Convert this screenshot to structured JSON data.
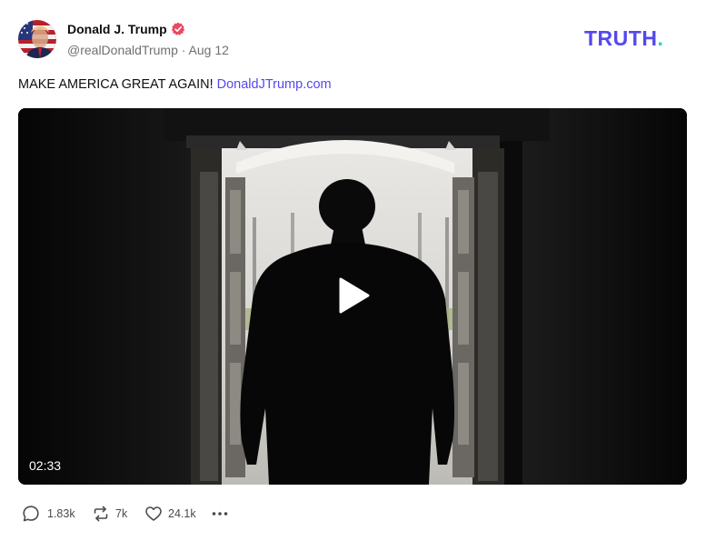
{
  "author": {
    "name": "Donald J. Trump",
    "handle": "@realDonaldTrump",
    "separator": "·",
    "date": "Aug 12",
    "verified_icon": "verified-badge-icon"
  },
  "brand": {
    "logo_text": "TRUTH",
    "logo_dot": ".",
    "logo_color": "#5448ee",
    "dot_color": "#26d4b8"
  },
  "post": {
    "text": "MAKE AMERICA GREAT AGAIN!",
    "link_text": "DonaldJTrump.com",
    "link_color": "#5448ee"
  },
  "video": {
    "duration": "02:33",
    "play_icon": "play-icon"
  },
  "actions": {
    "replies": {
      "icon": "reply-icon",
      "count": "1.83k"
    },
    "retruths": {
      "icon": "retruth-icon",
      "count": "7k"
    },
    "likes": {
      "icon": "heart-icon",
      "count": "24.1k"
    },
    "more": {
      "icon": "more-icon"
    }
  },
  "colors": {
    "verified": "#e84a5f",
    "muted_text": "#707070"
  }
}
